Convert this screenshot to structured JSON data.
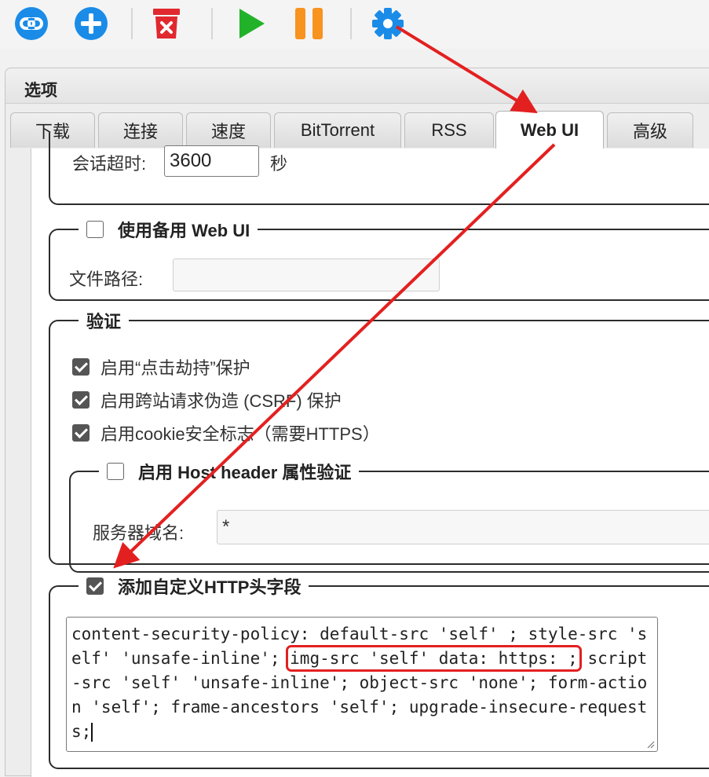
{
  "toolbar": {
    "items": [
      "connect-icon",
      "add-icon",
      "delete-icon",
      "start-icon",
      "pause-icon",
      "settings-icon"
    ],
    "colors": {
      "blue": "#1a8ce8",
      "red": "#e0282e",
      "green": "#22b22a",
      "orange": "#f7931e"
    }
  },
  "dialog": {
    "title": "选项"
  },
  "tabs": [
    {
      "label": "下载"
    },
    {
      "label": "连接"
    },
    {
      "label": "速度"
    },
    {
      "label": "BitTorrent"
    },
    {
      "label": "RSS"
    },
    {
      "label": "Web UI",
      "active": true
    },
    {
      "label": "高级"
    }
  ],
  "session": {
    "label": "会话超时:",
    "value": "3600",
    "unit": "秒"
  },
  "alt_webui": {
    "legend": "使用备用 Web UI",
    "checked": false,
    "path_label": "文件路径:",
    "path_value": ""
  },
  "auth": {
    "legend": "验证",
    "options": [
      {
        "label": "启用“点击劫持”保护",
        "checked": true
      },
      {
        "label": "启用跨站请求伪造 (CSRF) 保护",
        "checked": true
      },
      {
        "label": "启用cookie安全标志（需要HTTPS）",
        "checked": true
      }
    ],
    "host_header": {
      "legend": "启用 Host header 属性验证",
      "checked": false,
      "domains_label": "服务器域名:",
      "domains_value": "*"
    }
  },
  "custom_headers": {
    "legend": "添加自定义HTTP头字段",
    "checked": true,
    "value_before": "content-security-policy: default-src 'self' ; style-src 'self' 'unsafe-inline'; ",
    "value_highlight": "img-src 'self' data: https: ;",
    "value_after": " script-src 'self' 'unsafe-inline'; object-src 'none'; form-action 'self'; frame-ancestors 'self'; upgrade-insecure-requests;"
  },
  "annotation": {
    "arrow_color": "#e32020",
    "highlight_color": "#e32020"
  }
}
